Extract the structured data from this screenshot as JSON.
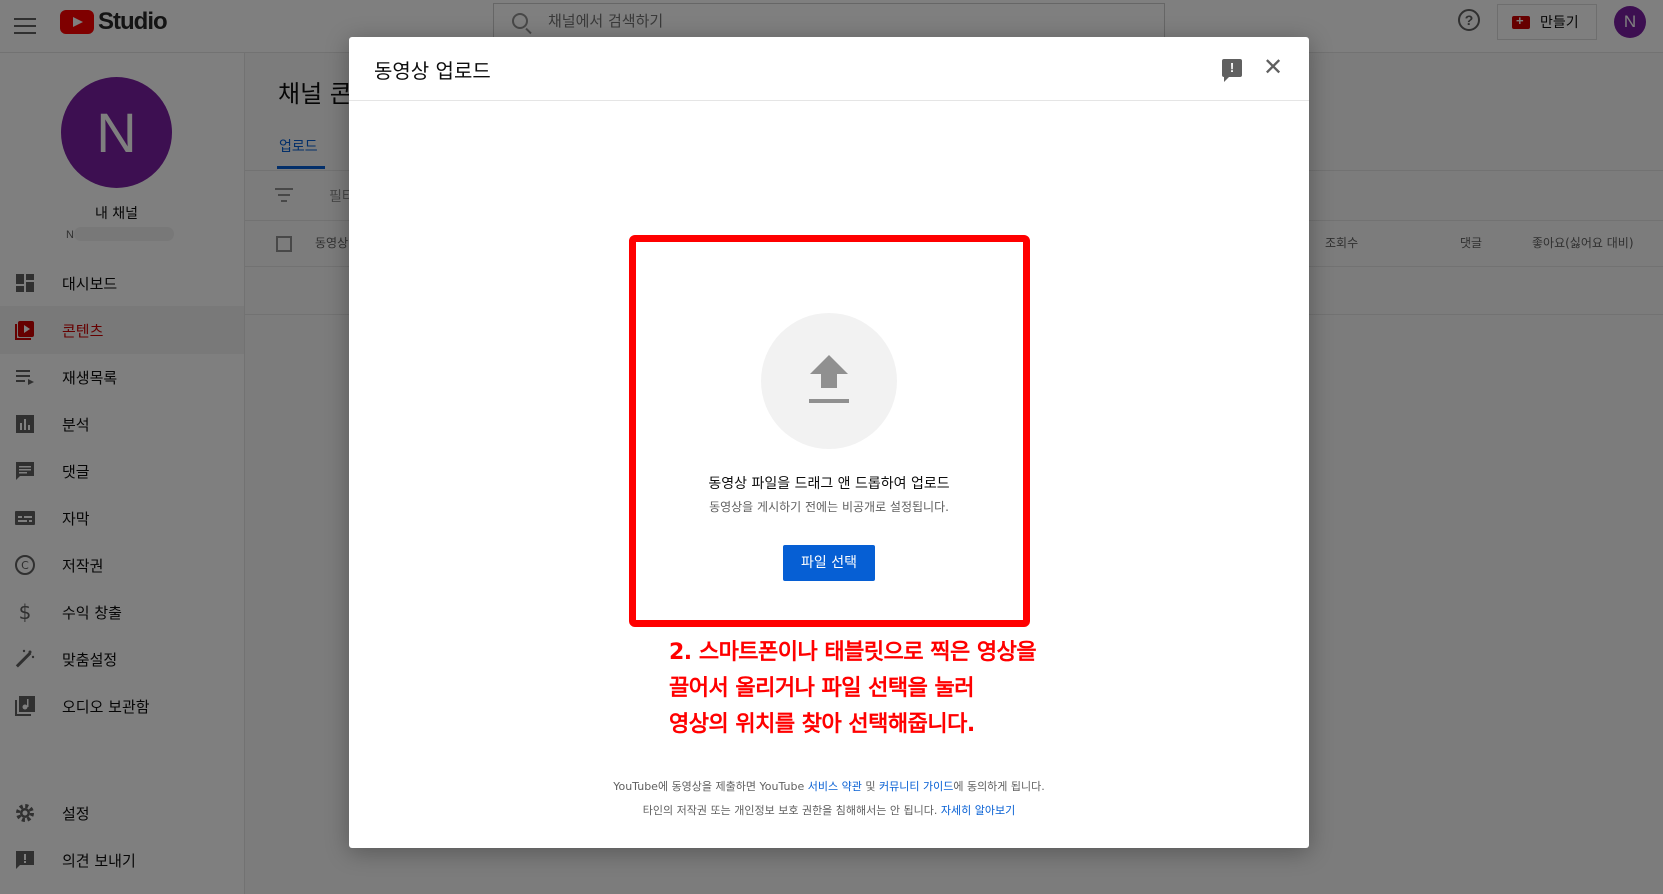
{
  "topbar": {
    "logo_text": "Studio",
    "search_placeholder": "채널에서 검색하기",
    "create_label": "만들기",
    "avatar_letter": "N"
  },
  "sidebar": {
    "avatar_letter": "N",
    "channel_name": "내 채널",
    "channel_sub": "N",
    "items": [
      {
        "label": "대시보드",
        "icon": "dashboard-icon"
      },
      {
        "label": "콘텐츠",
        "icon": "content-icon",
        "active": true
      },
      {
        "label": "재생목록",
        "icon": "playlist-icon"
      },
      {
        "label": "분석",
        "icon": "analytics-icon"
      },
      {
        "label": "댓글",
        "icon": "comments-icon"
      },
      {
        "label": "자막",
        "icon": "subtitles-icon"
      },
      {
        "label": "저작권",
        "icon": "copyright-icon"
      },
      {
        "label": "수익 창출",
        "icon": "dollar-icon"
      },
      {
        "label": "맞춤설정",
        "icon": "magic-wand-icon"
      },
      {
        "label": "오디오 보관함",
        "icon": "audio-library-icon"
      }
    ],
    "bottom_items": [
      {
        "label": "설정",
        "icon": "gear-icon"
      },
      {
        "label": "의견 보내기",
        "icon": "feedback-icon"
      }
    ]
  },
  "main": {
    "title": "채널 콘",
    "tab": "업로드",
    "filter_label": "필터",
    "columns": [
      "동영상",
      "조회수",
      "댓글",
      "좋아요(싫어요 대비)"
    ]
  },
  "dialog": {
    "title": "동영상 업로드",
    "drag_text": "동영상 파일을 드래그 앤 드롭하여 업로드",
    "private_text": "동영상을 게시하기 전에는 비공개로 설정됩니다.",
    "select_button": "파일 선택",
    "annotation": [
      "2. 스마트폰이나 태블릿으로 찍은 영상을",
      "끌어서 올리거나 파일 선택을 눌러",
      "영상의 위치를 찾아 선택해줍니다."
    ],
    "terms": {
      "line1_a": "YouTube에 동영상을 제출하면 YouTube ",
      "line1_link1": "서비스 약관",
      "line1_b": " 및 ",
      "line1_link2": "커뮤니티 가이드",
      "line1_c": "에 동의하게 됩니다.",
      "line2_a": "타인의 저작권 또는 개인정보 보호 권한을 침해해서는 안 됩니다. ",
      "line2_link": "자세히 알아보기"
    },
    "annotation_color": "#ff0000",
    "accent_color": "#065fd4"
  }
}
